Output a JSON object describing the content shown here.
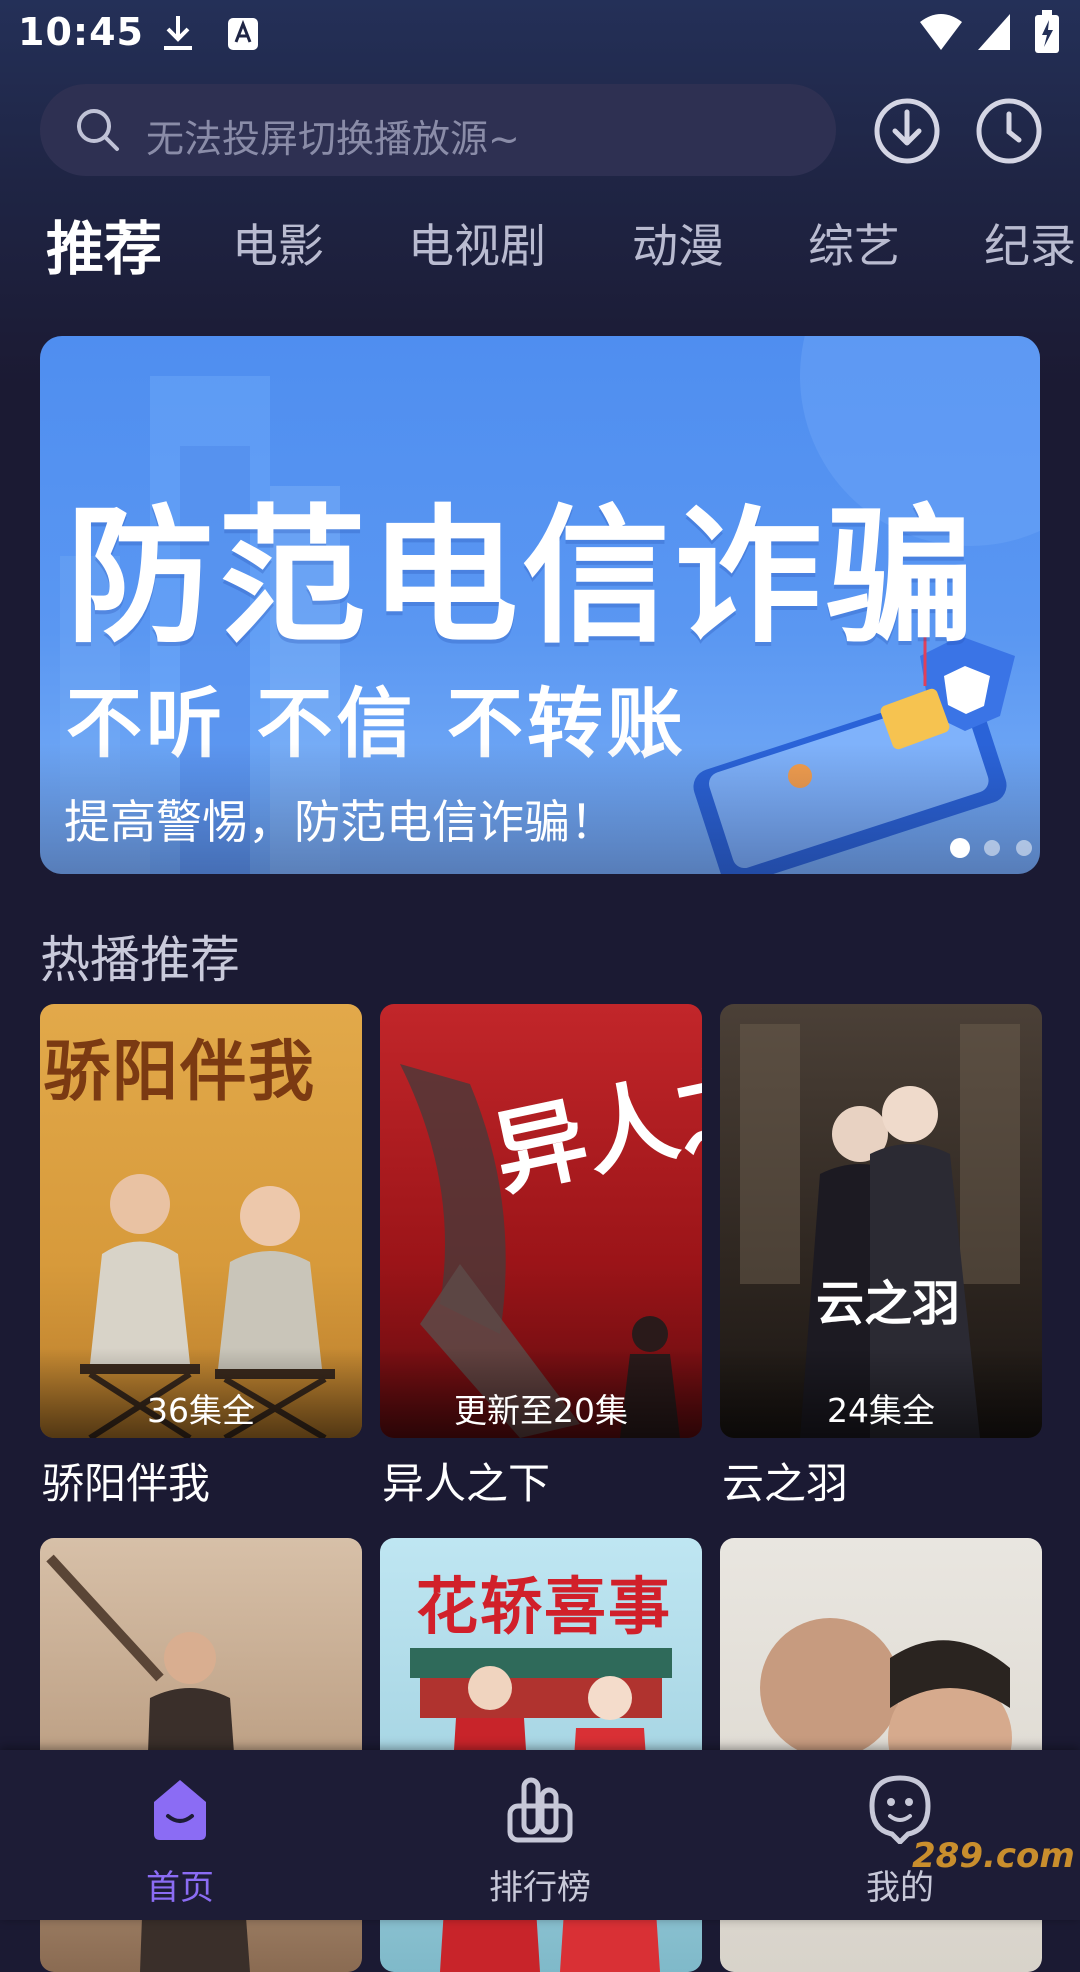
{
  "status_bar": {
    "time": "10:45"
  },
  "search": {
    "placeholder": "无法投屏切换播放源~"
  },
  "tabs": [
    {
      "label": "推荐",
      "active": true
    },
    {
      "label": "电影"
    },
    {
      "label": "电视剧"
    },
    {
      "label": "动漫"
    },
    {
      "label": "综艺"
    },
    {
      "label": "纪录"
    }
  ],
  "banner": {
    "headline": "防范电信诈骗",
    "subline": "不听 不信 不转账",
    "caption": "提高警惕，防范电信诈骗！",
    "page_count": 3,
    "active_page": 1
  },
  "hot": {
    "title": "热播推荐",
    "items": [
      {
        "title": "骄阳伴我",
        "badge": "36集全",
        "poster_text": "骄阳伴我"
      },
      {
        "title": "异人之下",
        "badge": "更新至20集",
        "poster_text": "异人之下"
      },
      {
        "title": "云之羽",
        "badge": "24集全",
        "poster_text": "云之羽"
      },
      {
        "title": "",
        "badge": "",
        "poster_text": ""
      },
      {
        "title": "",
        "badge": "",
        "poster_text": "花轿喜事"
      },
      {
        "title": "",
        "badge": "",
        "poster_text": ""
      }
    ]
  },
  "bottom_nav": [
    {
      "label": "首页",
      "icon": "home-icon",
      "active": true
    },
    {
      "label": "排行榜",
      "icon": "ranking-icon"
    },
    {
      "label": "我的",
      "icon": "profile-icon"
    }
  ],
  "watermark": "289.com",
  "colors": {
    "accent": "#8b6cf4",
    "background": "#1b1a33",
    "banner": "#5a97f2"
  }
}
